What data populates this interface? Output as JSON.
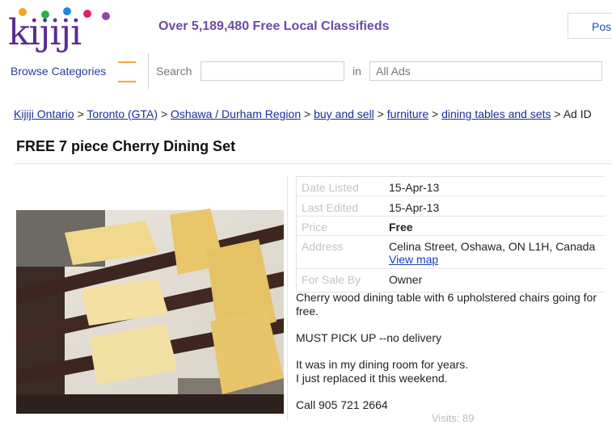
{
  "header": {
    "logo_text": "kijiji",
    "tagline": "Over 5,189,480 Free Local Classifieds",
    "post_label": "Pos"
  },
  "nav": {
    "browse_label": "Browse Categories",
    "search_label": "Search",
    "search_value": "",
    "in_label": "in",
    "category_selected": "All Ads"
  },
  "breadcrumb": [
    "Kijiji Ontario",
    "Toronto (GTA)",
    "Oshawa / Durham Region",
    "buy and sell",
    "furniture",
    "dining tables and sets"
  ],
  "breadcrumb_tail": "> Ad ID",
  "listing": {
    "title": "FREE 7 piece Cherry Dining Set",
    "details": [
      {
        "label": "Date Listed",
        "value": "15-Apr-13"
      },
      {
        "label": "Last Edited",
        "value": "15-Apr-13"
      },
      {
        "label": "Price",
        "value": "Free"
      },
      {
        "label": "Address",
        "value": "Celina Street, Oshawa, ON L1H, Canada",
        "link": "View map"
      },
      {
        "label": "For Sale By",
        "value": "Owner"
      }
    ],
    "description": [
      "Cherry wood dining table with 6 upholstered chairs going for free.",
      "MUST PICK UP --no delivery",
      "It was in my dining room for years.",
      "I just replaced it this weekend.",
      "Call 905 721 2664"
    ],
    "visits": "Visits: 89"
  },
  "colors": {
    "brand_purple": "#5b2d8e",
    "link_blue": "#1a2d9a",
    "accent_orange": "#f4a63a"
  }
}
